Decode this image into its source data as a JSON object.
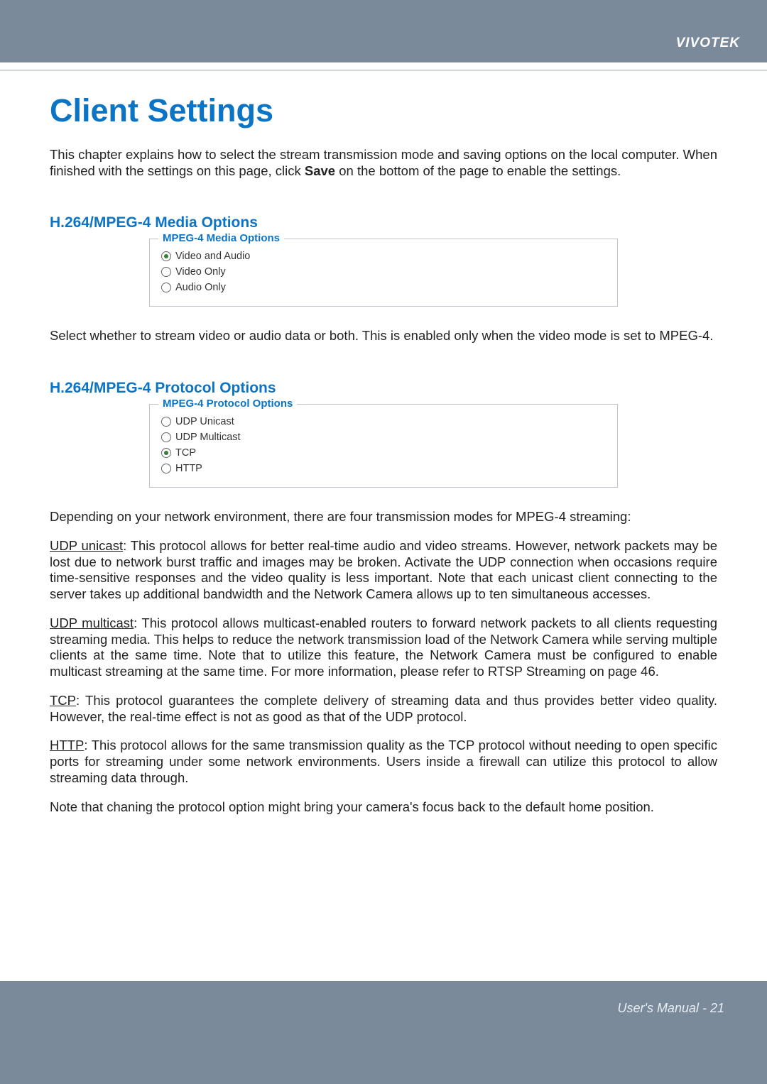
{
  "header": {
    "brand": "VIVOTEK"
  },
  "title": "Client Settings",
  "intro_prefix": "This chapter explains how to select the stream transmission mode and saving options on the local computer. When finished with the settings on this page, click ",
  "intro_save": "Save",
  "intro_suffix": " on the bottom of the page to enable the settings.",
  "media_heading": "H.264/MPEG-4 Media Options",
  "media_box": {
    "legend": "MPEG-4 Media Options",
    "options": [
      {
        "label": "Video and Audio",
        "selected": true
      },
      {
        "label": "Video Only",
        "selected": false
      },
      {
        "label": "Audio Only",
        "selected": false
      }
    ]
  },
  "media_note": "Select whether to stream video or audio data or both. This is enabled only when the video mode is set to MPEG-4.",
  "protocol_heading": "H.264/MPEG-4 Protocol Options",
  "protocol_box": {
    "legend": "MPEG-4 Protocol Options",
    "options": [
      {
        "label": "UDP Unicast",
        "selected": false
      },
      {
        "label": "UDP Multicast",
        "selected": false
      },
      {
        "label": "TCP",
        "selected": true
      },
      {
        "label": "HTTP",
        "selected": false
      }
    ]
  },
  "protocol_intro": "Depending on your network environment, there are four transmission modes for MPEG-4 streaming:",
  "udp_unicast_label": "UDP unicast",
  "udp_unicast_text": ": This protocol allows for better real-time audio and video streams. However, network packets may be lost due to network burst traffic and images may be broken. Activate the UDP connection when occasions require time-sensitive responses and the video quality is less important. Note that each unicast client connecting to the server takes up additional bandwidth and the Network Camera allows up to ten simultaneous accesses.",
  "udp_multicast_label": "UDP multicast",
  "udp_multicast_text": ": This protocol allows multicast-enabled routers to forward network packets to all clients requesting streaming media. This helps to reduce the network transmission load of the Network Camera while serving multiple clients at the same time. Note that to utilize this feature, the Network Camera must be configured to enable multicast streaming at the same time. For more information, please refer to RTSP Streaming on page 46.",
  "tcp_label": "TCP",
  "tcp_text": ": This protocol guarantees the complete delivery of streaming data and thus provides better video quality. However, the real-time effect is not as good as that of the UDP protocol.",
  "http_label": "HTTP",
  "http_text": ": This protocol allows for the same transmission quality as the TCP protocol without needing to open specific ports for streaming under some network environments. Users inside a firewall can utilize this protocol to allow streaming data through.",
  "focus_note": "Note that chaning the protocol option might bring your camera's focus back to the default home position.",
  "footer": "User's Manual - 21"
}
